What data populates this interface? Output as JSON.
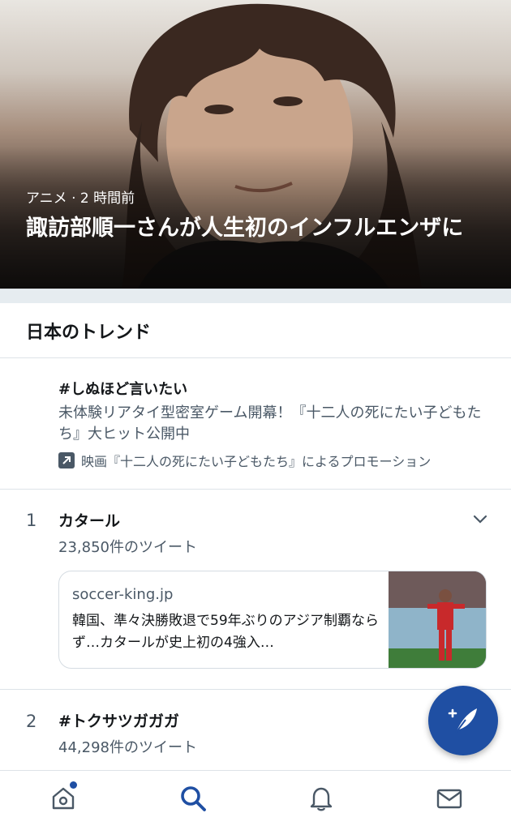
{
  "hero": {
    "meta": "アニメ · 2 時間前",
    "title": "諏訪部順一さんが人生初のインフルエンザに"
  },
  "section": {
    "title": "日本のトレンド"
  },
  "promoted": {
    "tag": "#しぬほど言いたい",
    "description": "未体験リアタイ型密室ゲーム開幕！『十二人の死にたい子どもたち』大ヒット公開中",
    "promotion": "映画『十二人の死にたい子どもたち』によるプロモーション",
    "icon": "promoted-arrow-icon"
  },
  "trends": [
    {
      "rank": "1",
      "name": "カタール",
      "count": "23,850件のツイート",
      "card": {
        "source": "soccer-king.jp",
        "text": "韓国、準々決勝敗退で59年ぶりのアジア制覇ならず…カタールが史上初の4強入…"
      }
    },
    {
      "rank": "2",
      "name": "#トクサツガガガ",
      "count": "44,298件のツイート"
    }
  ],
  "nav": {
    "items": [
      "home-icon",
      "search-icon",
      "notifications-icon",
      "messages-icon"
    ],
    "active": "search-icon"
  },
  "colors": {
    "accent": "#1f4fa3",
    "text": "#14171a",
    "secondary": "#4a5866",
    "divider": "#dde3e8"
  }
}
